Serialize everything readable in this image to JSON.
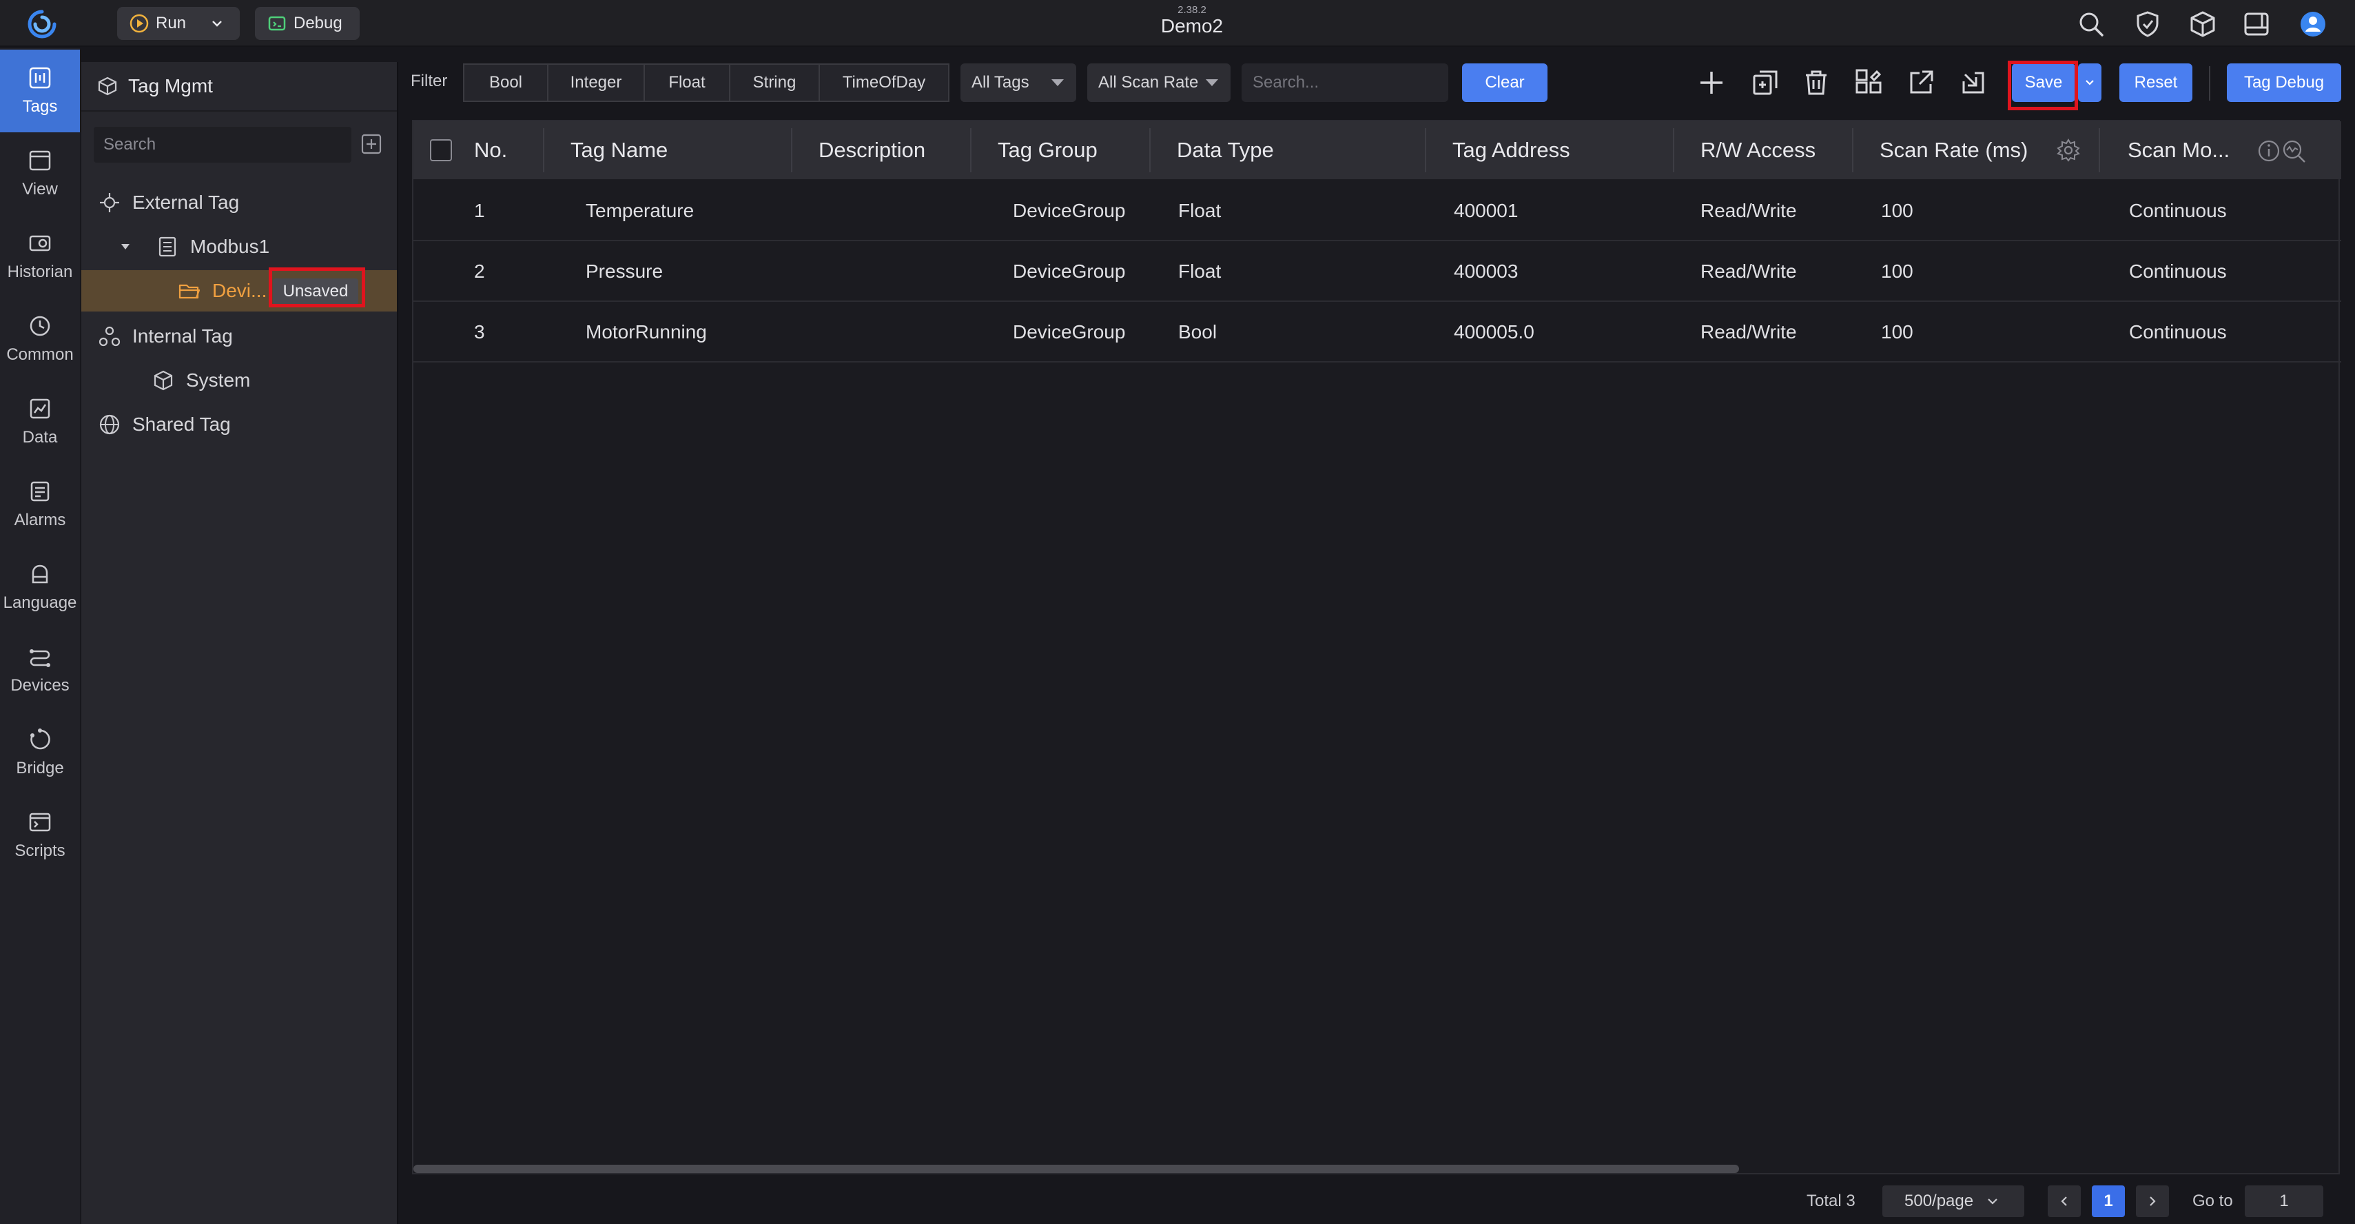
{
  "app": {
    "version": "2.38.2",
    "project_name": "Demo2"
  },
  "topbar": {
    "run_label": "Run",
    "debug_label": "Debug"
  },
  "rail": {
    "items": [
      {
        "label": "Tags",
        "icon": "tags-icon",
        "active": true
      },
      {
        "label": "View",
        "icon": "view-icon"
      },
      {
        "label": "Historian",
        "icon": "historian-icon"
      },
      {
        "label": "Common",
        "icon": "common-icon"
      },
      {
        "label": "Data",
        "icon": "data-icon"
      },
      {
        "label": "Alarms",
        "icon": "alarms-icon"
      },
      {
        "label": "Language",
        "icon": "language-icon"
      },
      {
        "label": "Devices",
        "icon": "devices-icon"
      },
      {
        "label": "Bridge",
        "icon": "bridge-icon"
      },
      {
        "label": "Scripts",
        "icon": "scripts-icon"
      }
    ]
  },
  "tree": {
    "title": "Tag Mgmt",
    "search_placeholder": "Search",
    "external_tag": "External Tag",
    "modbus": "Modbus1",
    "device_group": "Devi...",
    "unsaved_badge": "Unsaved",
    "internal_tag": "Internal Tag",
    "system": "System",
    "shared_tag": "Shared Tag"
  },
  "filter": {
    "label": "Filter",
    "types": [
      "Bool",
      "Integer",
      "Float",
      "String",
      "TimeOfDay"
    ],
    "all_tags": "All Tags",
    "all_scan_rate": "All Scan Rate",
    "search_placeholder": "Search...",
    "clear": "Clear"
  },
  "toolbar": {
    "save": "Save",
    "reset": "Reset",
    "tag_debug": "Tag Debug"
  },
  "table": {
    "columns": [
      "No.",
      "Tag Name",
      "Description",
      "Tag Group",
      "Data Type",
      "Tag Address",
      "R/W Access",
      "Scan Rate (ms)",
      "Scan Mo..."
    ],
    "rows": [
      {
        "no": "1",
        "name": "Temperature",
        "description": "",
        "group": "DeviceGroup",
        "type": "Float",
        "address": "400001",
        "access": "Read/Write",
        "scan_rate": "100",
        "scan_mode": "Continuous"
      },
      {
        "no": "2",
        "name": "Pressure",
        "description": "",
        "group": "DeviceGroup",
        "type": "Float",
        "address": "400003",
        "access": "Read/Write",
        "scan_rate": "100",
        "scan_mode": "Continuous"
      },
      {
        "no": "3",
        "name": "MotorRunning",
        "description": "",
        "group": "DeviceGroup",
        "type": "Bool",
        "address": "400005.0",
        "access": "Read/Write",
        "scan_rate": "100",
        "scan_mode": "Continuous"
      }
    ]
  },
  "footer": {
    "total": "Total 3",
    "page_size": "500/page",
    "current_page": "1",
    "goto_label": "Go to",
    "goto_value": "1"
  },
  "colors": {
    "accent": "#4a7ef0",
    "highlight": "#e0141e",
    "selected_folder": "#f0a040"
  }
}
